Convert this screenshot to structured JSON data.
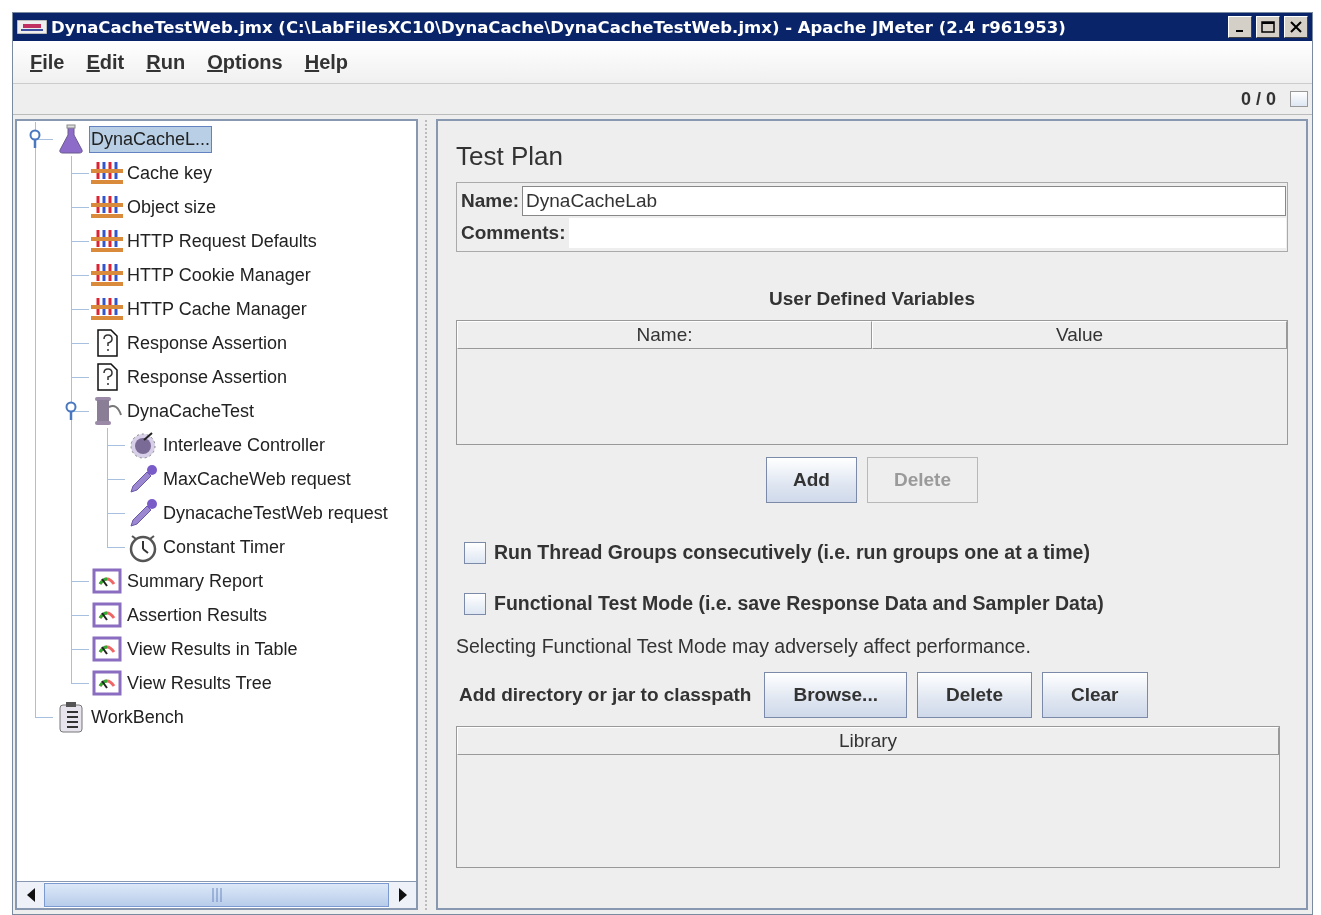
{
  "window": {
    "title": "DynaCacheTestWeb.jmx (C:\\LabFilesXC10\\DynaCache\\DynaCacheTestWeb.jmx) - Apache JMeter (2.4 r961953)"
  },
  "menu": [
    "File",
    "Edit",
    "Run",
    "Options",
    "Help"
  ],
  "toolbar": {
    "counter": "0 / 0"
  },
  "tree": [
    {
      "label": "DynaCacheL...",
      "kind": "testplan",
      "selected": true,
      "expanded": true,
      "children": [
        {
          "label": "Cache key",
          "kind": "config",
          "selected": false
        },
        {
          "label": "Object size",
          "kind": "config",
          "selected": false
        },
        {
          "label": "HTTP Request Defaults",
          "kind": "config",
          "selected": false
        },
        {
          "label": "HTTP Cookie Manager",
          "kind": "config",
          "selected": false
        },
        {
          "label": "HTTP Cache Manager",
          "kind": "config",
          "selected": false
        },
        {
          "label": "Response Assertion",
          "kind": "assertion",
          "selected": false
        },
        {
          "label": "Response Assertion",
          "kind": "assertion",
          "selected": false
        },
        {
          "label": "DynaCacheTest",
          "kind": "threadgroup",
          "selected": false,
          "expanded": true,
          "children": [
            {
              "label": "Interleave Controller",
              "kind": "controller",
              "selected": false
            },
            {
              "label": "MaxCacheWeb request",
              "kind": "sampler",
              "selected": false
            },
            {
              "label": "DynacacheTestWeb request",
              "kind": "sampler",
              "selected": false
            },
            {
              "label": "Constant Timer",
              "kind": "timer",
              "selected": false
            }
          ]
        },
        {
          "label": "Summary Report",
          "kind": "listener",
          "selected": false
        },
        {
          "label": "Assertion Results",
          "kind": "listener",
          "selected": false
        },
        {
          "label": "View Results in Table",
          "kind": "listener",
          "selected": false
        },
        {
          "label": "View Results Tree",
          "kind": "listener",
          "selected": false
        }
      ]
    },
    {
      "label": "WorkBench",
      "kind": "workbench",
      "selected": false
    }
  ],
  "panel": {
    "title": "Test Plan",
    "name_label": "Name:",
    "name_value": "DynaCacheLab",
    "comments_label": "Comments:",
    "variables": {
      "title": "User Defined Variables",
      "columns": [
        "Name:",
        "Value"
      ],
      "buttons": [
        {
          "label": "Add",
          "disabled": false
        },
        {
          "label": "Delete",
          "disabled": true
        }
      ]
    },
    "options": [
      {
        "label": "Run Thread Groups consecutively (i.e. run groups one at a time)",
        "checked": false
      },
      {
        "label": "Functional Test Mode (i.e. save Response Data and Sampler Data)",
        "checked": false
      }
    ],
    "note": "Selecting Functional Test Mode may adversely affect performance.",
    "classpath": {
      "label": "Add directory or jar to classpath",
      "buttons": [
        {
          "label": "Browse...",
          "disabled": false
        },
        {
          "label": "Delete",
          "disabled": false
        },
        {
          "label": "Clear",
          "disabled": false
        }
      ]
    },
    "library": {
      "columns": [
        "Library"
      ]
    }
  }
}
